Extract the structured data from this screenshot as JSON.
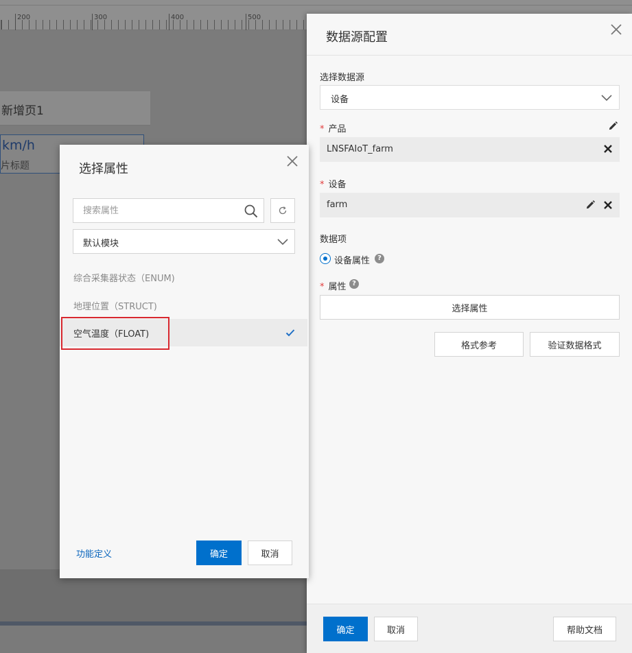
{
  "background": {
    "ruler_ticks": [
      "200",
      "300",
      "400",
      "500"
    ],
    "page_tab_title": "新增页1",
    "widget_value": "km/h",
    "widget_subtitle": "片标题"
  },
  "drawer": {
    "title": "数据源配置",
    "datasource_label": "选择数据源",
    "datasource_value": "设备",
    "product_label": "产品",
    "product_value": "LNSFAIoT_farm",
    "device_label": "设备",
    "device_value": "farm",
    "data_item_label": "数据项",
    "radio_label": "设备属性",
    "property_label": "属性",
    "select_property_button": "选择属性",
    "format_ref_button": "格式参考",
    "validate_format_button": "验证数据格式",
    "confirm_button": "确定",
    "cancel_button": "取消",
    "help_doc_button": "帮助文档",
    "required_mark": "*",
    "help_mark": "?"
  },
  "modal": {
    "title": "选择属性",
    "search_placeholder": "搜索属性",
    "module_value": "默认模块",
    "items": [
      {
        "label": "综合采集器状态（ENUM)"
      },
      {
        "label": "地理位置（STRUCT)"
      },
      {
        "label": "空气温度（FLOAT)"
      }
    ],
    "footer_link": "功能定义",
    "confirm_button": "确定",
    "cancel_button": "取消"
  },
  "colors": {
    "primary": "#0070cc",
    "required": "#e23c3c",
    "highlight": "#d8282f",
    "link": "#0b66bd"
  }
}
